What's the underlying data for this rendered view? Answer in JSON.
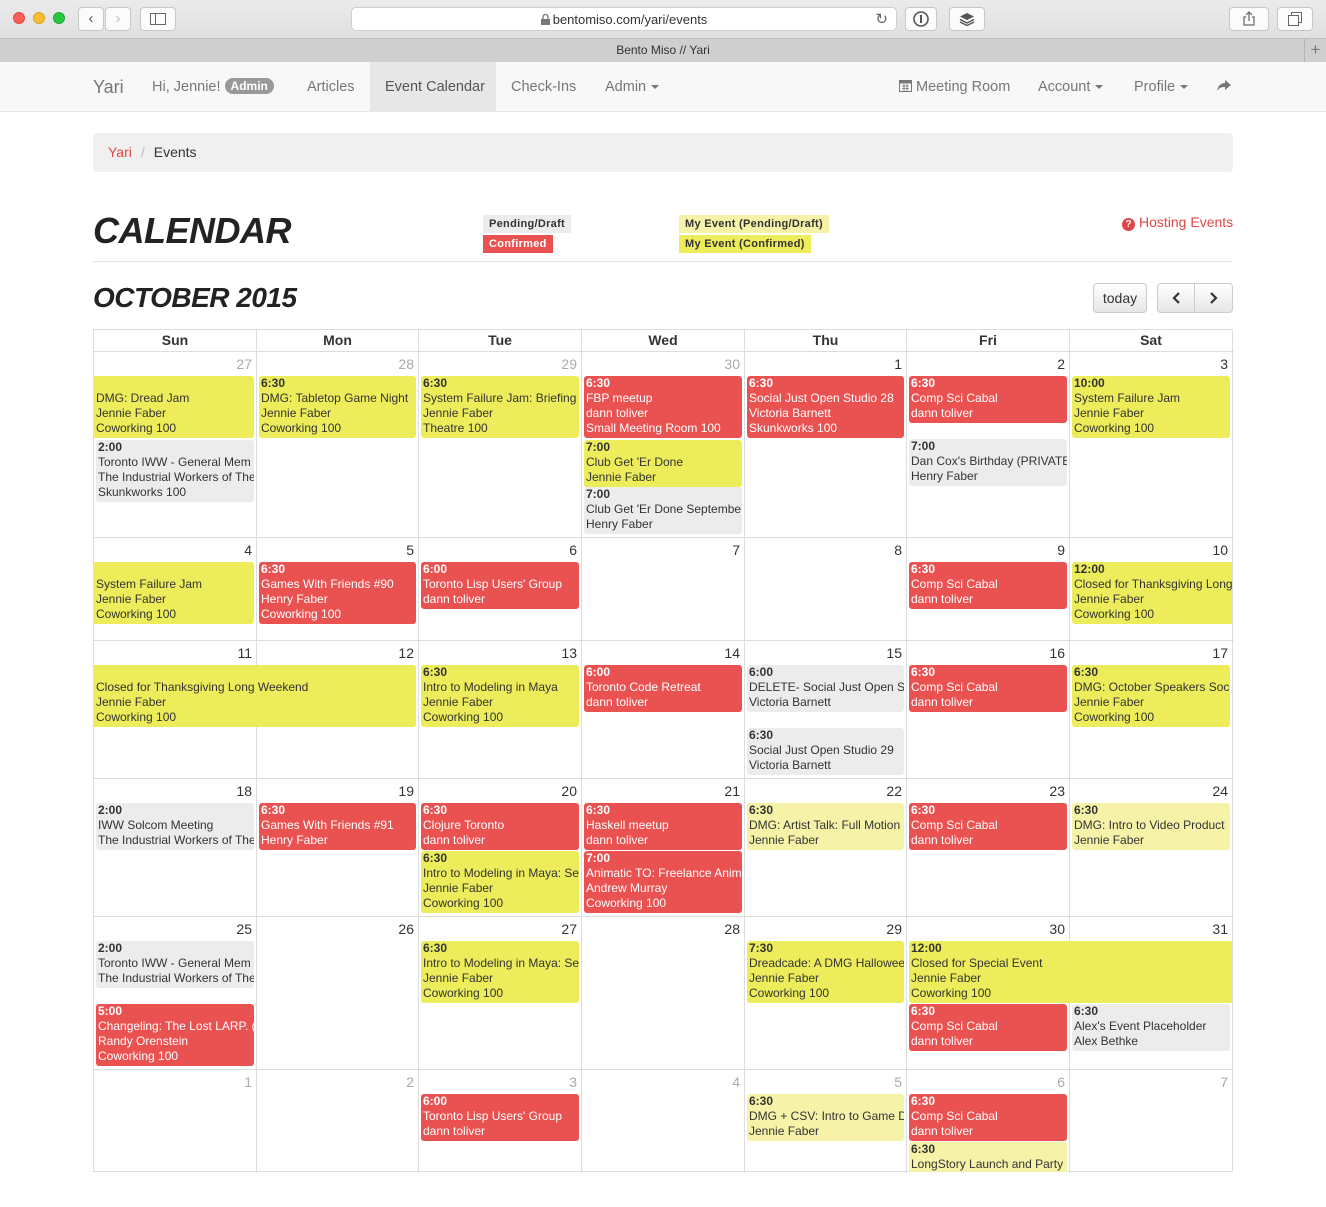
{
  "browser": {
    "url": "bentomiso.com/yari/events",
    "tab_title": "Bento Miso // Yari"
  },
  "nav": {
    "brand": "Yari",
    "greeting": "Hi, Jennie!",
    "admin_badge": "Admin",
    "articles": "Articles",
    "event_calendar": "Event Calendar",
    "check_ins": "Check-Ins",
    "admin": "Admin",
    "meeting_room": "Meeting Room",
    "account": "Account",
    "profile": "Profile"
  },
  "breadcrumb": {
    "home": "Yari",
    "current": "Events"
  },
  "page_title": "CALENDAR",
  "legend": {
    "pending": "Pending/Draft",
    "confirmed": "Confirmed",
    "my_pending": "My Event (Pending/Draft)",
    "my_confirmed": "My Event (Confirmed)"
  },
  "hosting_link": "Hosting Events",
  "month_title": "OCTOBER 2015",
  "today_button": "today",
  "weekdays": [
    "Sun",
    "Mon",
    "Tue",
    "Wed",
    "Thu",
    "Fri",
    "Sat"
  ],
  "weeks": [
    [
      "27",
      "28",
      "29",
      "30",
      "1",
      "2",
      "3"
    ],
    [
      "4",
      "5",
      "6",
      "7",
      "8",
      "9",
      "10"
    ],
    [
      "11",
      "12",
      "13",
      "14",
      "15",
      "16",
      "17"
    ],
    [
      "18",
      "19",
      "20",
      "21",
      "22",
      "23",
      "24"
    ],
    [
      "25",
      "26",
      "27",
      "28",
      "29",
      "30",
      "31"
    ],
    [
      "1",
      "2",
      "3",
      "4",
      "5",
      "6",
      "7"
    ]
  ],
  "events": [
    {
      "lines": [
        "",
        "DMG: Dread Jam",
        "Jennie Faber",
        "Coworking 100"
      ]
    },
    {
      "lines": [
        "2:00",
        "Toronto IWW - General Mem",
        "The Industrial Workers of The",
        "Skunkworks 100"
      ]
    },
    {
      "lines": [
        "6:30",
        "DMG: Tabletop Game Night",
        "Jennie Faber",
        "Coworking 100"
      ]
    },
    {
      "lines": [
        "6:30",
        "System Failure Jam: Briefing",
        "Jennie Faber",
        "Theatre 100"
      ]
    },
    {
      "lines": [
        "6:30",
        "FBP meetup",
        "dann toliver",
        "Small Meeting Room 100"
      ]
    },
    {
      "lines": [
        "7:00",
        "Club Get 'Er Done",
        "Jennie Faber"
      ]
    },
    {
      "lines": [
        "7:00",
        "Club Get 'Er Done Septembe",
        "Henry Faber"
      ]
    },
    {
      "lines": [
        "6:30",
        "Social Just Open Studio 28",
        "Victoria Barnett",
        "Skunkworks 100"
      ]
    },
    {
      "lines": [
        "6:30",
        "Comp Sci Cabal",
        "dann toliver"
      ]
    },
    {
      "lines": [
        "7:00",
        "Dan Cox's Birthday (PRIVATE)",
        "Henry Faber"
      ]
    },
    {
      "lines": [
        "10:00",
        "System Failure Jam",
        "Jennie Faber",
        "Coworking 100"
      ]
    },
    {
      "lines": [
        "",
        "System Failure Jam",
        "Jennie Faber",
        "Coworking 100"
      ]
    },
    {
      "lines": [
        "6:30",
        "Games With Friends #90",
        "Henry Faber",
        "Coworking 100"
      ]
    },
    {
      "lines": [
        "6:00",
        "Toronto Lisp Users' Group",
        "dann toliver"
      ]
    },
    {
      "lines": [
        "6:30",
        "Comp Sci Cabal",
        "dann toliver"
      ]
    },
    {
      "lines": [
        "12:00",
        "Closed for Thanksgiving Long",
        "Jennie Faber",
        "Coworking 100"
      ]
    },
    {
      "lines": [
        "",
        "Closed for Thanksgiving Long Weekend",
        "Jennie Faber",
        "Coworking 100"
      ]
    },
    {
      "lines": [
        "6:30",
        "Intro to Modeling in Maya",
        "Jennie Faber",
        "Coworking 100"
      ]
    },
    {
      "lines": [
        "6:00",
        "Toronto Code Retreat",
        "dann toliver"
      ]
    },
    {
      "lines": [
        "6:00",
        "DELETE- Social Just Open St",
        "Victoria Barnett"
      ]
    },
    {
      "lines": [
        "6:30",
        "Social Just Open Studio 29",
        "Victoria Barnett"
      ]
    },
    {
      "lines": [
        "6:30",
        "Comp Sci Cabal",
        "dann toliver"
      ]
    },
    {
      "lines": [
        "6:30",
        "DMG: October Speakers Soci",
        "Jennie Faber",
        "Coworking 100"
      ]
    },
    {
      "lines": [
        "2:00",
        "IWW Solcom Meeting",
        "The Industrial Workers of The"
      ]
    },
    {
      "lines": [
        "6:30",
        "Games With Friends #91",
        "Henry Faber"
      ]
    },
    {
      "lines": [
        "6:30",
        "Clojure Toronto",
        "dann toliver"
      ]
    },
    {
      "lines": [
        "6:30",
        "Intro to Modeling in Maya: Se",
        "Jennie Faber",
        "Coworking 100"
      ]
    },
    {
      "lines": [
        "6:30",
        "Haskell meetup",
        "dann toliver"
      ]
    },
    {
      "lines": [
        "7:00",
        "Animatic TO: Freelance Anim",
        "Andrew Murray",
        "Coworking 100"
      ]
    },
    {
      "lines": [
        "6:30",
        "DMG: Artist Talk: Full Motion",
        "Jennie Faber"
      ]
    },
    {
      "lines": [
        "6:30",
        "Comp Sci Cabal",
        "dann toliver"
      ]
    },
    {
      "lines": [
        "6:30",
        "DMG: Intro to Video Product",
        "Jennie Faber"
      ]
    },
    {
      "lines": [
        "2:00",
        "Toronto IWW - General Mem",
        "The Industrial Workers of The"
      ]
    },
    {
      "lines": [
        "5:00",
        "Changeling: The Lost LARP. (",
        "Randy Orenstein",
        "Coworking 100"
      ]
    },
    {
      "lines": [
        "6:30",
        "Intro to Modeling in Maya: Se",
        "Jennie Faber",
        "Coworking 100"
      ]
    },
    {
      "lines": [
        "7:30",
        "Dreadcade: A DMG Hallowee",
        "Jennie Faber",
        "Coworking 100"
      ]
    },
    {
      "lines": [
        "12:00",
        "Closed for Special Event",
        "Jennie Faber",
        "Coworking 100"
      ]
    },
    {
      "lines": [
        "6:30",
        "Comp Sci Cabal",
        "dann toliver"
      ]
    },
    {
      "lines": [
        "6:30",
        "Alex's Event Placeholder",
        "Alex Bethke"
      ]
    },
    {
      "lines": [
        "6:00",
        "Toronto Lisp Users' Group",
        "dann toliver"
      ]
    },
    {
      "lines": [
        "6:30",
        "DMG + CSV: Intro to Game D",
        "Jennie Faber"
      ]
    },
    {
      "lines": [
        "6:30",
        "Comp Sci Cabal",
        "dann toliver"
      ]
    },
    {
      "lines": [
        "6:30",
        "LongStory Launch and Party"
      ]
    }
  ]
}
